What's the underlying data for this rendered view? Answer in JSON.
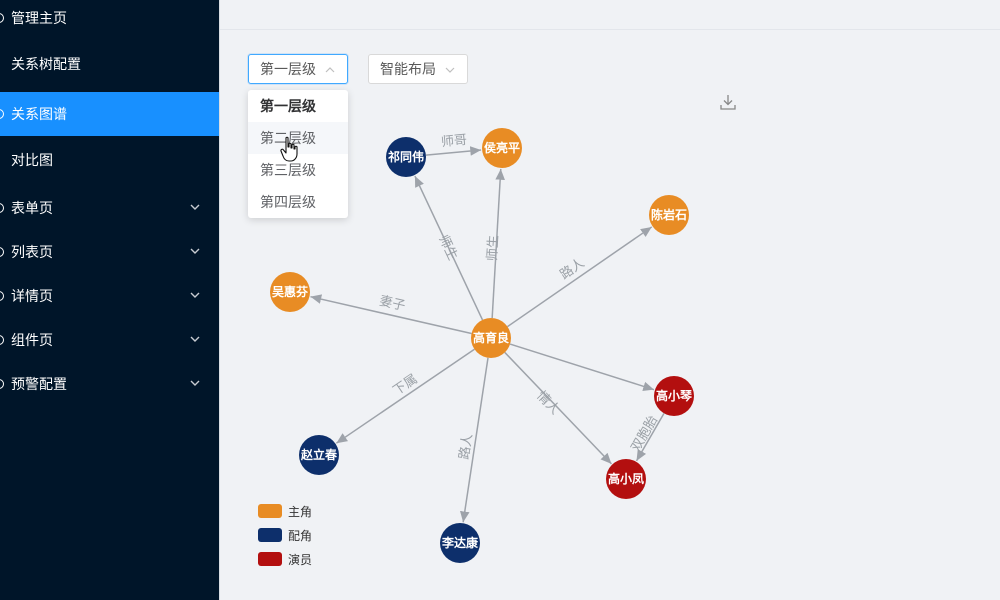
{
  "sidebar": {
    "items": [
      {
        "label": "管理主页",
        "has_dot": true,
        "has_chevron": false,
        "active": false
      },
      {
        "label": "关系树配置",
        "has_dot": false,
        "has_chevron": false,
        "active": false
      },
      {
        "label": "关系图谱",
        "has_dot": true,
        "has_chevron": false,
        "active": true
      },
      {
        "label": "对比图",
        "has_dot": false,
        "has_chevron": false,
        "active": false
      },
      {
        "label": "表单页",
        "has_dot": true,
        "has_chevron": true,
        "active": false
      },
      {
        "label": "列表页",
        "has_dot": true,
        "has_chevron": true,
        "active": false
      },
      {
        "label": "详情页",
        "has_dot": true,
        "has_chevron": true,
        "active": false
      },
      {
        "label": "组件页",
        "has_dot": true,
        "has_chevron": true,
        "active": false
      },
      {
        "label": "预警配置",
        "has_dot": true,
        "has_chevron": true,
        "active": false
      }
    ]
  },
  "toolbar": {
    "level_select": {
      "value": "第一层级",
      "icon": "chevron-up-icon"
    },
    "layout_select": {
      "value": "智能布局",
      "icon": "chevron-down-icon"
    },
    "download_icon": "download-icon"
  },
  "level_dropdown": {
    "options": [
      "第一层级",
      "第二层级",
      "第三层级",
      "第四层级"
    ],
    "selected_index": 0,
    "hover_index": 1
  },
  "graph": {
    "nodes": [
      {
        "id": "gao_yuliang",
        "name": "高育良",
        "role": "主角"
      },
      {
        "id": "qi_tongwei",
        "name": "祁同伟",
        "role": "配角"
      },
      {
        "id": "hou_liangping",
        "name": "侯亮平",
        "role": "主角"
      },
      {
        "id": "chen_yanshi",
        "name": "陈岩石",
        "role": "主角"
      },
      {
        "id": "wu_huifen",
        "name": "吴惠芬",
        "role": "主角"
      },
      {
        "id": "gao_xiaoqin",
        "name": "高小琴",
        "role": "演员"
      },
      {
        "id": "gao_xiaofeng",
        "name": "高小凤",
        "role": "演员"
      },
      {
        "id": "zhao_lichun",
        "name": "赵立春",
        "role": "配角"
      },
      {
        "id": "li_dakang",
        "name": "李达康",
        "role": "配角"
      }
    ],
    "edges": [
      {
        "from": "gao_yuliang",
        "to": "qi_tongwei",
        "label": "师生"
      },
      {
        "from": "gao_yuliang",
        "to": "hou_liangping",
        "label": "师生"
      },
      {
        "from": "qi_tongwei",
        "to": "hou_liangping",
        "label": "师哥"
      },
      {
        "from": "gao_yuliang",
        "to": "chen_yanshi",
        "label": "路人"
      },
      {
        "from": "gao_yuliang",
        "to": "wu_huifen",
        "label": "妻子"
      },
      {
        "from": "gao_yuliang",
        "to": "gao_xiaoqin",
        "label": ""
      },
      {
        "from": "gao_yuliang",
        "to": "gao_xiaofeng",
        "label": "情人"
      },
      {
        "from": "gao_xiaoqin",
        "to": "gao_xiaofeng",
        "label": "双胞胎"
      },
      {
        "from": "gao_yuliang",
        "to": "zhao_lichun",
        "label": "下属"
      },
      {
        "from": "gao_yuliang",
        "to": "li_dakang",
        "label": "路人"
      }
    ]
  },
  "legend": [
    {
      "label": "主角",
      "color": "#e88c24"
    },
    {
      "label": "配角",
      "color": "#0d2f6b"
    },
    {
      "label": "演员",
      "color": "#b30f0f"
    }
  ],
  "colors": {
    "accent": "#1890ff",
    "sidebar_bg": "#001529",
    "edge": "#9ea3aa",
    "edge_label": "#9aa0a6"
  }
}
